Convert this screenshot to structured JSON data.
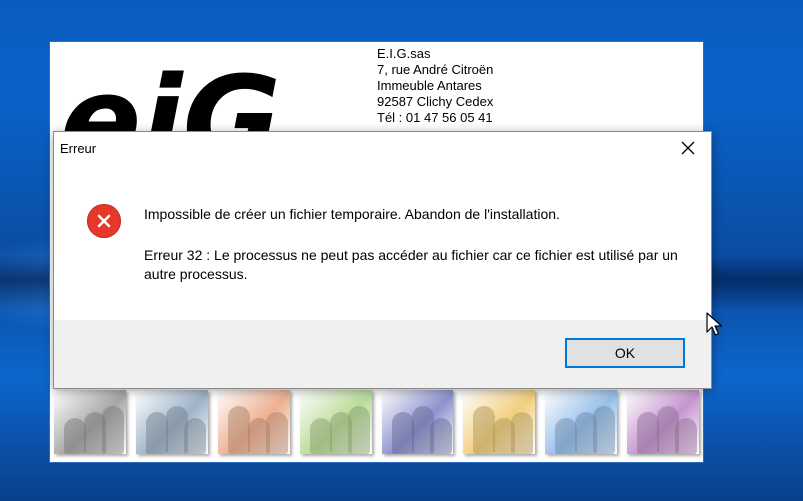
{
  "splash": {
    "logo_text": "eiG",
    "address": {
      "line1": "E.I.G.sas",
      "line2": "7, rue André Citroën",
      "line3": "Immeuble Antares",
      "line4": "92587 Clichy Cedex",
      "line5": "Tél : 01 47 56 05 41"
    },
    "tile_colors": [
      "#a7a7a7",
      "#9fb3c8",
      "#eeb090",
      "#b9dc98",
      "#8d93cf",
      "#f2cf7e",
      "#98c0ea",
      "#c596cf"
    ]
  },
  "dialog": {
    "title": "Erreur",
    "message": "Impossible de créer un fichier temporaire. Abandon de l'installation.",
    "detail": "Erreur 32 : Le processus ne peut pas accéder au fichier car ce fichier est utilisé par un autre processus.",
    "ok_label": "OK",
    "icon": "error-icon",
    "accent_color": "#0078d7",
    "error_color": "#e5382a"
  }
}
